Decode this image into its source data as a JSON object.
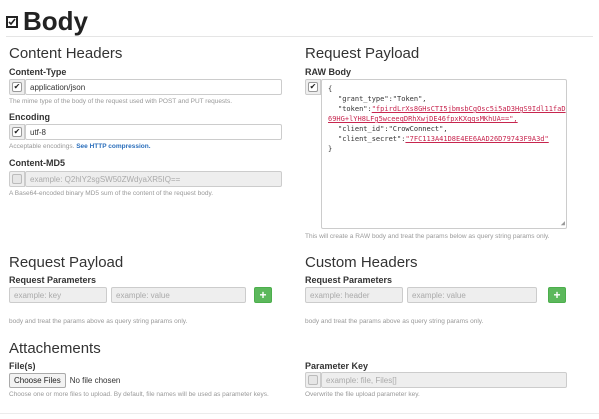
{
  "header": {
    "icon": "square-check-icon",
    "title": "Body"
  },
  "content_headers": {
    "title": "Content Headers",
    "content_type": {
      "label": "Content-Type",
      "value": "application/json",
      "checked": true,
      "help": "The mime type of the body of the request used with POST and PUT requests."
    },
    "encoding": {
      "label": "Encoding",
      "value": "utf-8",
      "checked": true,
      "help_prefix": "Acceptable encodings. ",
      "help_link": "See HTTP compression."
    },
    "content_md5": {
      "label": "Content-MD5",
      "placeholder": "example: Q2hlY2sgSW50ZWdyaXR5IQ==",
      "checked": false,
      "help": "A Base64-encoded binary MD5 sum of the content of the request body."
    }
  },
  "request_payload_raw": {
    "title": "Request Payload",
    "label": "RAW Body",
    "checked": true,
    "lines": {
      "l1": "{",
      "l2_key": "\"grant_type\":",
      "l2_val": "\"Token\",",
      "l3_key": "\"token\":",
      "l3_val": "\"fpirdLrXs8GHsCTI5jbmsbCgOsc5i5aD3HgS9Idl11faD",
      "l4_val": "69HG+lYH8LFg5wceeqDRhXwjDE46fpxKXqqsMKhUA==\",",
      "l5": "\"client_id\":\"CrowConnect\",",
      "l6_key": "\"client_secret\":",
      "l6_val": "\"7FC113A41D8E4EE6AAD26D79743F9A3d\"",
      "l7": "}"
    },
    "help": "This will create a RAW body and treat the params below as query string params only."
  },
  "request_payload_params": {
    "title": "Request Payload",
    "label": "Request Parameters",
    "key_placeholder": "example: key",
    "value_placeholder": "example: value",
    "add_label": "+",
    "help": "body and treat the params above as query string params only."
  },
  "custom_headers": {
    "title": "Custom Headers",
    "label": "Request Parameters",
    "key_placeholder": "example: header",
    "value_placeholder": "example: value",
    "add_label": "+",
    "help": "body and treat the params above as query string params only."
  },
  "attachments": {
    "title": "Attachements",
    "files_label": "File(s)",
    "choose_label": "Choose Files",
    "no_file": "No file chosen",
    "help": "Choose one or more files to upload. By default, file names will be used as parameter keys.",
    "param_key_label": "Parameter Key",
    "param_key_placeholder": "example: file, Files[]",
    "param_key_help": "Overwrite the file upload parameter key."
  },
  "colors": {
    "accent": "#5cb85c",
    "link": "#2a6ebb",
    "raw_value": "#c7254e"
  }
}
